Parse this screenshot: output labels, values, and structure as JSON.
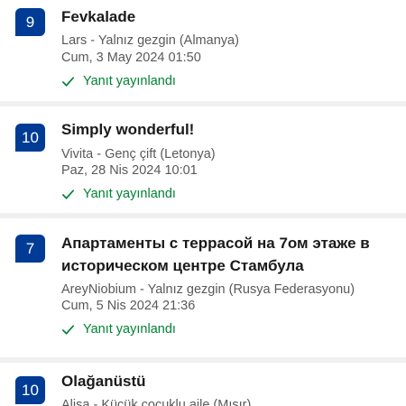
{
  "reviews": [
    {
      "score": "9",
      "title": "Fevkalade",
      "reviewer": "Lars - Yalnız gezgin (Almanya)",
      "date": "Cum, 3 May 2024 01:50",
      "reply_status": "Yanıt yayınlandı"
    },
    {
      "score": "10",
      "title": "Simply wonderful!",
      "reviewer": "Vivita - Genç çift (Letonya)",
      "date": "Paz, 28 Nis 2024 10:01",
      "reply_status": "Yanıt yayınlandı"
    },
    {
      "score": "7",
      "title_line1": "Апартаменты с террасой на 7ом этаже в",
      "title_line2": "историческом центре Стамбула",
      "reviewer": "AreyNiobium - Yalnız gezgin (Rusya Federasyonu)",
      "date": "Cum, 5 Nis 2024 21:36",
      "reply_status": "Yanıt yayınlandı"
    },
    {
      "score": "10",
      "title": "Olağanüstü",
      "reviewer": "Alisa - Küçük çocuklu aile (Mısır)"
    }
  ],
  "colors": {
    "badge_bg": "#003b95",
    "reply_green": "#008234",
    "divider": "#f0f0f0"
  },
  "icons": {
    "reply_status": "check-icon"
  }
}
